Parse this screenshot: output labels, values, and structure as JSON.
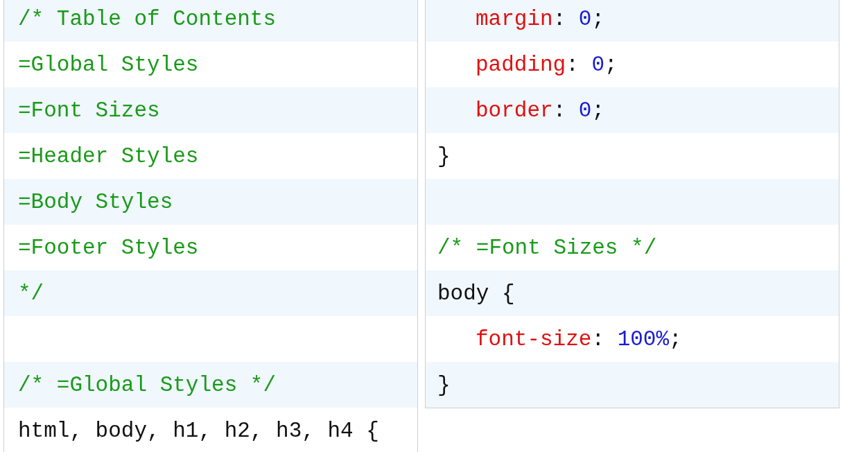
{
  "panels": [
    {
      "lines": [
        {
          "kind": "code",
          "tokens": [
            {
              "kind": "comment",
              "text": "/* Table of Contents"
            }
          ]
        },
        {
          "kind": "code",
          "tokens": [
            {
              "kind": "comment",
              "text": "=Global Styles"
            }
          ]
        },
        {
          "kind": "code",
          "tokens": [
            {
              "kind": "comment",
              "text": "=Font Sizes"
            }
          ]
        },
        {
          "kind": "code",
          "tokens": [
            {
              "kind": "comment",
              "text": "=Header Styles"
            }
          ]
        },
        {
          "kind": "code",
          "tokens": [
            {
              "kind": "comment",
              "text": "=Body Styles"
            }
          ]
        },
        {
          "kind": "code",
          "tokens": [
            {
              "kind": "comment",
              "text": "=Footer Styles"
            }
          ]
        },
        {
          "kind": "code",
          "tokens": [
            {
              "kind": "comment",
              "text": "*/"
            }
          ]
        },
        {
          "kind": "blank"
        },
        {
          "kind": "code",
          "tokens": [
            {
              "kind": "comment",
              "text": "/* =Global Styles */"
            }
          ]
        },
        {
          "kind": "code",
          "tokens": [
            {
              "kind": "plain",
              "text": "html, body, h1, h2, h3, h4 {"
            }
          ]
        }
      ]
    },
    {
      "lines": [
        {
          "kind": "group",
          "children": [
            {
              "kind": "code",
              "tokens": [
                {
                  "kind": "property",
                  "text": "margin"
                },
                {
                  "kind": "plain",
                  "text": ": "
                },
                {
                  "kind": "value",
                  "text": "0"
                },
                {
                  "kind": "plain",
                  "text": ";"
                }
              ]
            },
            {
              "kind": "code",
              "tokens": [
                {
                  "kind": "property",
                  "text": "padding"
                },
                {
                  "kind": "plain",
                  "text": ": "
                },
                {
                  "kind": "value",
                  "text": "0"
                },
                {
                  "kind": "plain",
                  "text": ";"
                }
              ]
            },
            {
              "kind": "code",
              "tokens": [
                {
                  "kind": "property",
                  "text": "border"
                },
                {
                  "kind": "plain",
                  "text": ": "
                },
                {
                  "kind": "value",
                  "text": "0"
                },
                {
                  "kind": "plain",
                  "text": ";"
                }
              ]
            }
          ]
        },
        {
          "kind": "code",
          "tokens": [
            {
              "kind": "plain",
              "text": "}"
            }
          ]
        },
        {
          "kind": "blank"
        },
        {
          "kind": "code",
          "tokens": [
            {
              "kind": "comment",
              "text": "/* =Font Sizes */"
            }
          ]
        },
        {
          "kind": "code",
          "tokens": [
            {
              "kind": "plain",
              "text": "body {"
            }
          ],
          "children": [
            {
              "kind": "code",
              "tokens": [
                {
                  "kind": "property",
                  "text": "font-size"
                },
                {
                  "kind": "plain",
                  "text": ": "
                },
                {
                  "kind": "value",
                  "text": "100%"
                },
                {
                  "kind": "plain",
                  "text": ";"
                }
              ]
            }
          ]
        },
        {
          "kind": "code",
          "tokens": [
            {
              "kind": "plain",
              "text": "}"
            }
          ]
        }
      ]
    }
  ]
}
